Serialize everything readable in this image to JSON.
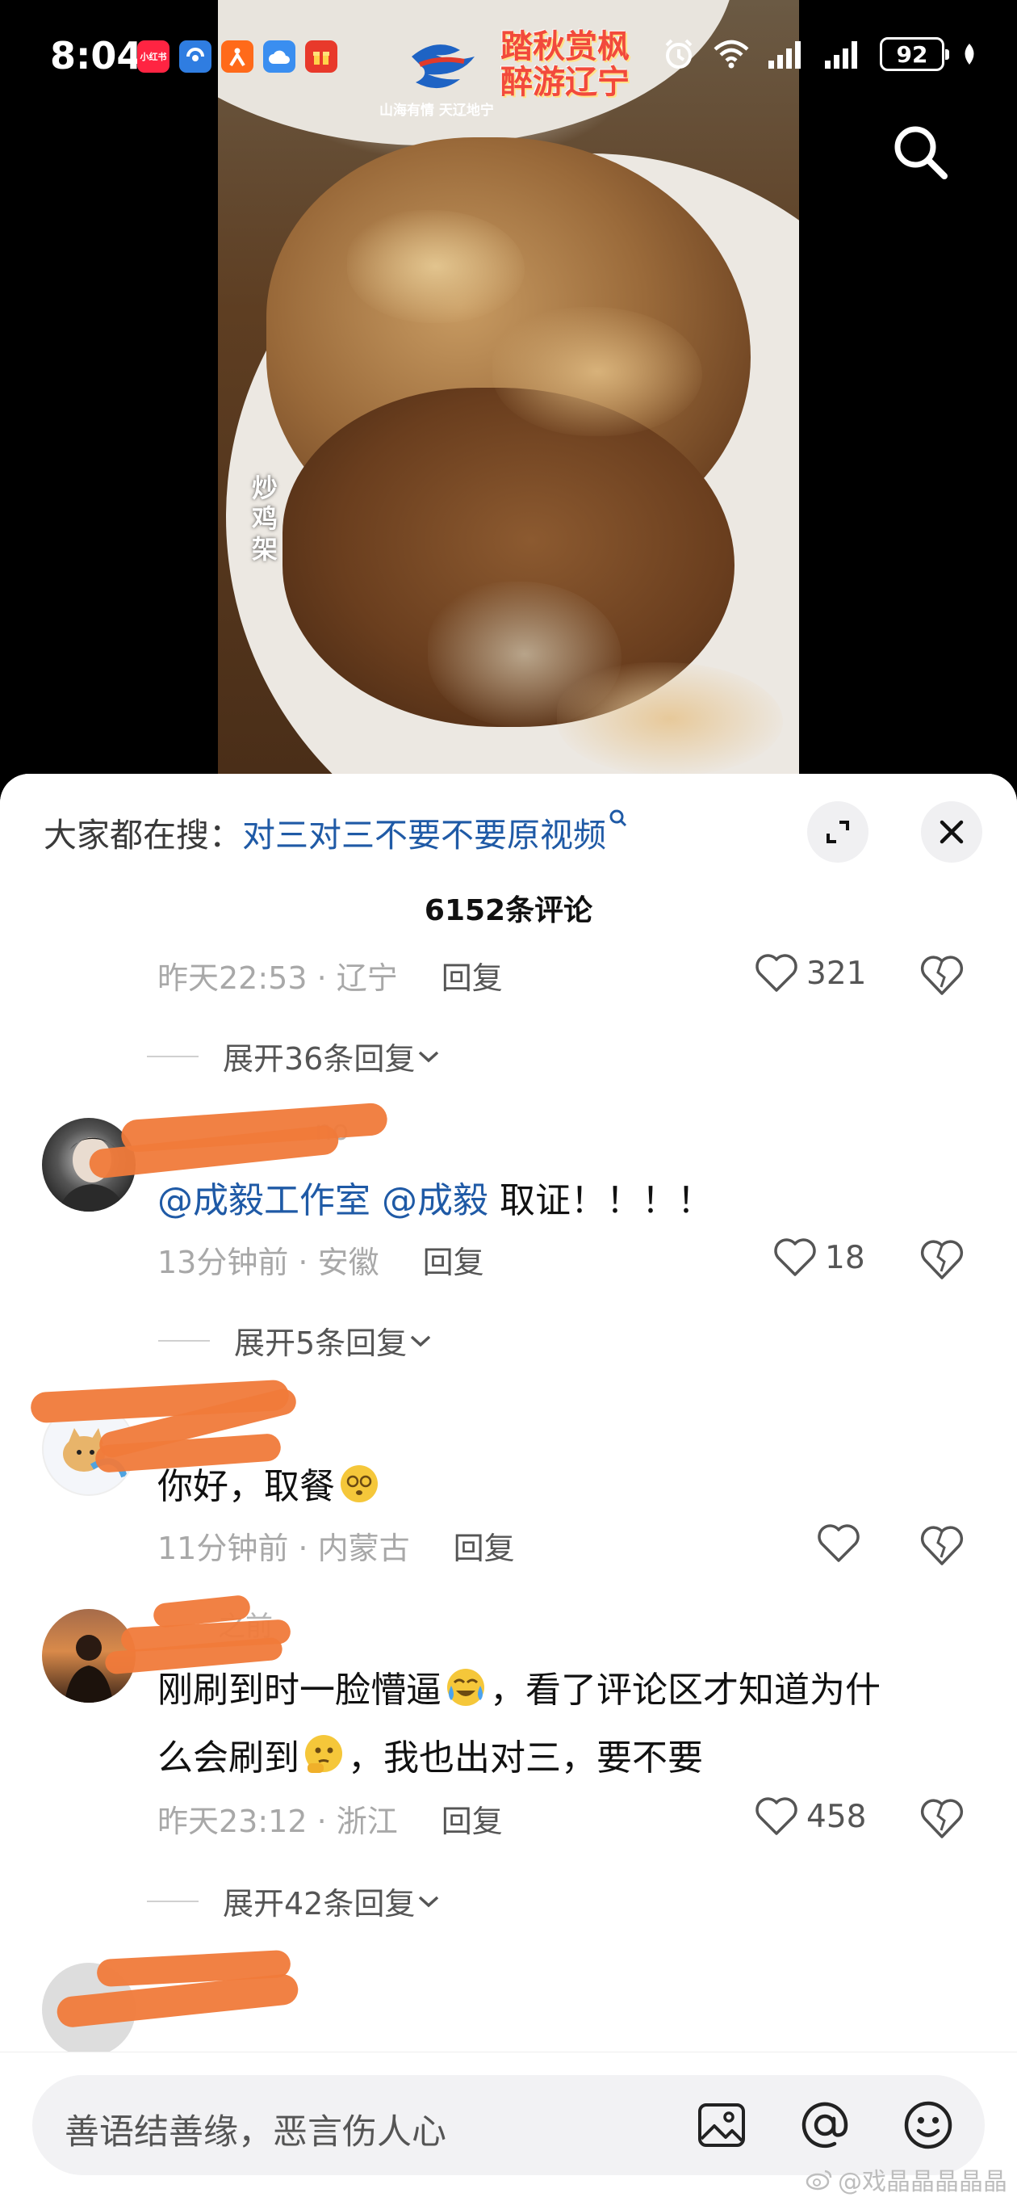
{
  "status_bar": {
    "time": "8:04",
    "battery": "92",
    "app_icons": [
      {
        "name": "xiaohongshu-app-icon",
        "text": "小红书",
        "color": "#ff2442"
      },
      {
        "name": "blue-app-icon",
        "text": "",
        "color": "#2f7de1"
      },
      {
        "name": "sports-app-icon",
        "text": "",
        "color": "#ff6a1a"
      },
      {
        "name": "cloud-app-icon",
        "text": "",
        "color": "#3a8ef0"
      },
      {
        "name": "gift-app-icon",
        "text": "",
        "color": "#e8392b"
      }
    ]
  },
  "video": {
    "dish_label": "炒鸡架",
    "promo_subtitle": "山海有情 天辽地宁",
    "promo_title": "踏秋赏枫醉游辽宁"
  },
  "sheet": {
    "hot_search_prefix": "大家都在搜：",
    "hot_search_query": "对三对三不要不要原视频",
    "comment_count_title": "6152条评论"
  },
  "comments": [
    {
      "id": "c0",
      "time": "昨天22:53 · 辽宁",
      "reply_label": "回复",
      "likes": "321",
      "expand": "展开36条回复"
    },
    {
      "id": "c1",
      "name_fragment": "no",
      "mention1": "@成毅工作室",
      "mention2": "@成毅",
      "text": " 取证！！！！",
      "time": "13分钟前 · 安徽",
      "reply_label": "回复",
      "likes": "18",
      "expand": "展开5条回复"
    },
    {
      "id": "c2",
      "text": "你好，取餐",
      "time": "11分钟前 · 内蒙古",
      "reply_label": "回复",
      "likes": ""
    },
    {
      "id": "c3",
      "name_fragment": "之前",
      "line1a": "刚刷到时一脸懵逼",
      "line1b": "，看了评论区才知道为什",
      "line2a": "么会刷到",
      "line2b": "，我也出对三，要不要",
      "time": "昨天23:12 · 浙江",
      "reply_label": "回复",
      "likes": "458",
      "expand": "展开42条回复"
    }
  ],
  "input": {
    "placeholder": "善语结善缘，恶言伤人心"
  },
  "watermark": "@戏晶晶晶晶晶",
  "colors": {
    "link": "#1f5aa6",
    "scribble": "#f07a3a",
    "muted_text": "#a8a8a8"
  }
}
